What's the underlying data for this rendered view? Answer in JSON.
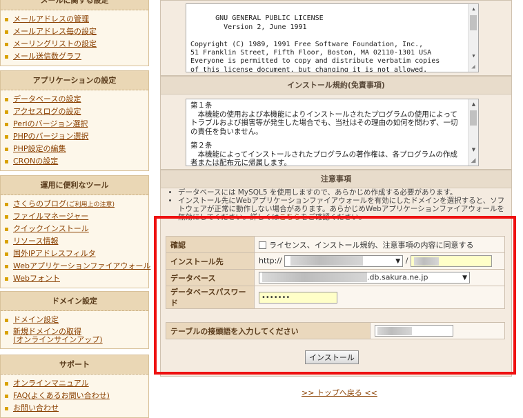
{
  "sidebar": {
    "groups": [
      {
        "title": "メールに関する設定",
        "items": [
          "メールアドレスの管理",
          "メールアドレス毎の設定",
          "メーリングリストの設定",
          "メール送信数グラフ"
        ]
      },
      {
        "title": "アプリケーションの設定",
        "items": [
          "データベースの設定",
          "アクセスログの設定",
          "Perlのバージョン選択",
          "PHPのバージョン選択",
          "PHP設定の編集",
          "CRONの設定"
        ]
      },
      {
        "title": "運用に便利なツール",
        "items": [
          "さくらのブログ",
          "ファイルマネージャー",
          "クイックインストール",
          "リソース情報",
          "国外IPアドレスフィルタ",
          "Webアプリケーションファイアウォール",
          "Webフォント"
        ],
        "blog_note": "(ご利用上の注意)"
      },
      {
        "title": "ドメイン設定",
        "items": [
          "ドメイン設定",
          "新規ドメインの取得",
          "(オンラインサインアップ)"
        ]
      },
      {
        "title": "サポート",
        "items": [
          "オンラインマニュアル",
          "FAQ(よくあるお問い合わせ)",
          "お問い合わせ"
        ]
      }
    ]
  },
  "license": {
    "text": "GNU GENERAL PUBLIC LICENSE\n        Version 2, June 1991\n\nCopyright (C) 1989, 1991 Free Software Foundation, Inc.,\n51 Franklin Street, Fifth Floor, Boston, MA 02110-1301 USA\nEveryone is permitted to copy and distribute verbatim copies\nof this license document, but changing it is not allowed."
  },
  "terms": {
    "title": "インストール規約(免責事項)",
    "text_1_head": "第１条",
    "text_1": "本機能の使用および本機能によりインストールされたプログラムの使用によってトラブルおよび損害等が発生した場合でも、当社はその理由の如何を問わず、一切の責任を負いません。",
    "text_2_head": "第２条",
    "text_2": "本機能によってインストールされたプログラムの著作権は、各プログラムの作成者または配布元に帰属します。"
  },
  "notes": {
    "title": "注意事項",
    "items": [
      "データベースには MySQL5 を使用しますので、あらかじめ作成する必要があります。",
      "インストール先にWebアプリケーションファイアウォールを有効にしたドメインを選択すると、ソフトウェアが正常に動作しない場合があります。あらかじめWebアプリケーションファイアウォールを無効にしてください。詳しくは"
    ],
    "link_text": "こちら",
    "link_suffix": "をご確認ください。"
  },
  "form": {
    "confirm_label": "確認",
    "confirm_text": "ライセンス、インストール規約、注意事項の内容に同意する",
    "dest_label": "インストール先",
    "dest_prefix": "http://",
    "dest_sep": "/",
    "db_label": "データベース",
    "db_suffix": ".db.sakura.ne.jp",
    "dbpass_label": "データベースパスワード",
    "dbpass_value": "•••••••",
    "prefix_label": "テーブルの接頭語を入力してください",
    "install_button": "インストール",
    "back_link": ">> トップへ戻る <<"
  },
  "colors": {
    "highlight": "#ee1111",
    "link": "#8a4000",
    "bullet": "#d9a200"
  }
}
